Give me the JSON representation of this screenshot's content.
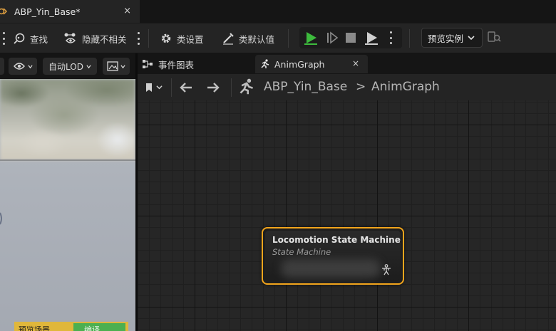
{
  "window": {
    "doc_tab_title": "ABP_Yin_Base*",
    "doc_tab_close": "×"
  },
  "toolbar": {
    "find_label": "查找",
    "hide_unrelated_label": "隐藏不相关",
    "class_settings_label": "类设置",
    "class_defaults_label": "类默认值",
    "preview_instance_label": "预览实例"
  },
  "viewport": {
    "lod_label": "自动LOD",
    "bottom_left_text": "预览场景",
    "compile_text": "编译"
  },
  "graph_tabs": [
    {
      "label": "事件图表",
      "active": false
    },
    {
      "label": "AnimGraph",
      "active": true,
      "close": "×"
    }
  ],
  "breadcrumb": {
    "root": "ABP_Yin_Base",
    "separator": ">",
    "current": "AnimGraph"
  },
  "node": {
    "title": "Locomotion State Machine",
    "subtitle": "State Machine",
    "border_color": "#f2a51c"
  },
  "colors": {
    "accent_play": "#3dbb3d",
    "node_outline": "#f2a51c",
    "panel_bg": "#242424"
  }
}
